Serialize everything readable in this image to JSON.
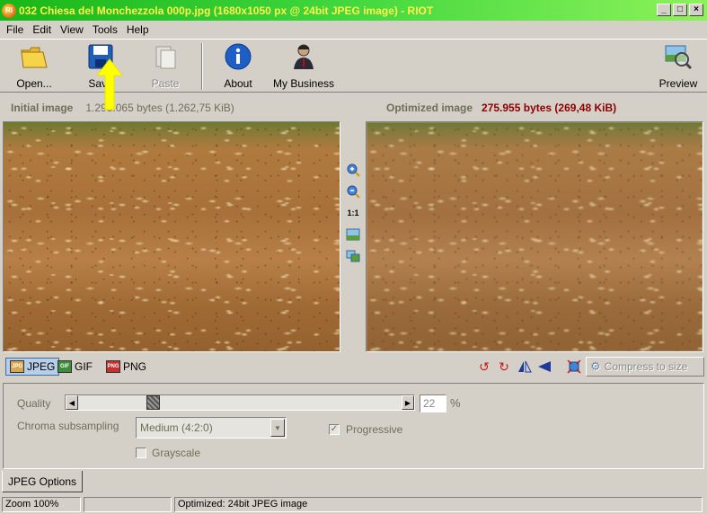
{
  "window": {
    "title": "032 Chiesa del Monchezzola 000p.jpg (1680x1050 px @ 24bit JPEG image) - RIOT",
    "app_icon_text": "RI",
    "minimize": "_",
    "maximize": "□",
    "close": "×"
  },
  "menu": {
    "file": "File",
    "edit": "Edit",
    "view": "View",
    "tools": "Tools",
    "help": "Help"
  },
  "toolbar": {
    "open": "Open...",
    "save": "Save",
    "paste": "Paste",
    "about": "About",
    "my_business": "My Business",
    "preview": "Preview"
  },
  "info": {
    "initial_label": "Initial image",
    "initial_value": "1.293.065 bytes (1.262,75 KiB)",
    "optimized_label": "Optimized image",
    "optimized_value": "275.955 bytes (269,48 KiB)"
  },
  "zoom": {
    "one_to_one": "1:1"
  },
  "formats": {
    "jpeg": "JPEG",
    "gif": "GIF",
    "png": "PNG",
    "jpeg_icon": "JPG",
    "gif_icon": "GIF",
    "png_icon": "PNG"
  },
  "compress": {
    "label": "Compress to size"
  },
  "options": {
    "quality_label": "Quality",
    "quality_value": "22",
    "quality_fraction": 0.22,
    "percent": "%",
    "chroma_label": "Chroma subsampling",
    "chroma_value": "Medium (4:2:0)",
    "progressive_label": "Progressive",
    "progressive_checked": true,
    "grayscale_label": "Grayscale",
    "grayscale_checked": false,
    "tab_label": "JPEG Options"
  },
  "status": {
    "zoom": "Zoom 100%",
    "middle": "",
    "optimized": "Optimized: 24bit JPEG image"
  },
  "colors": {
    "title_text": "#fff44a",
    "size_value": "#8b0000",
    "arrow": "#ffff00"
  }
}
